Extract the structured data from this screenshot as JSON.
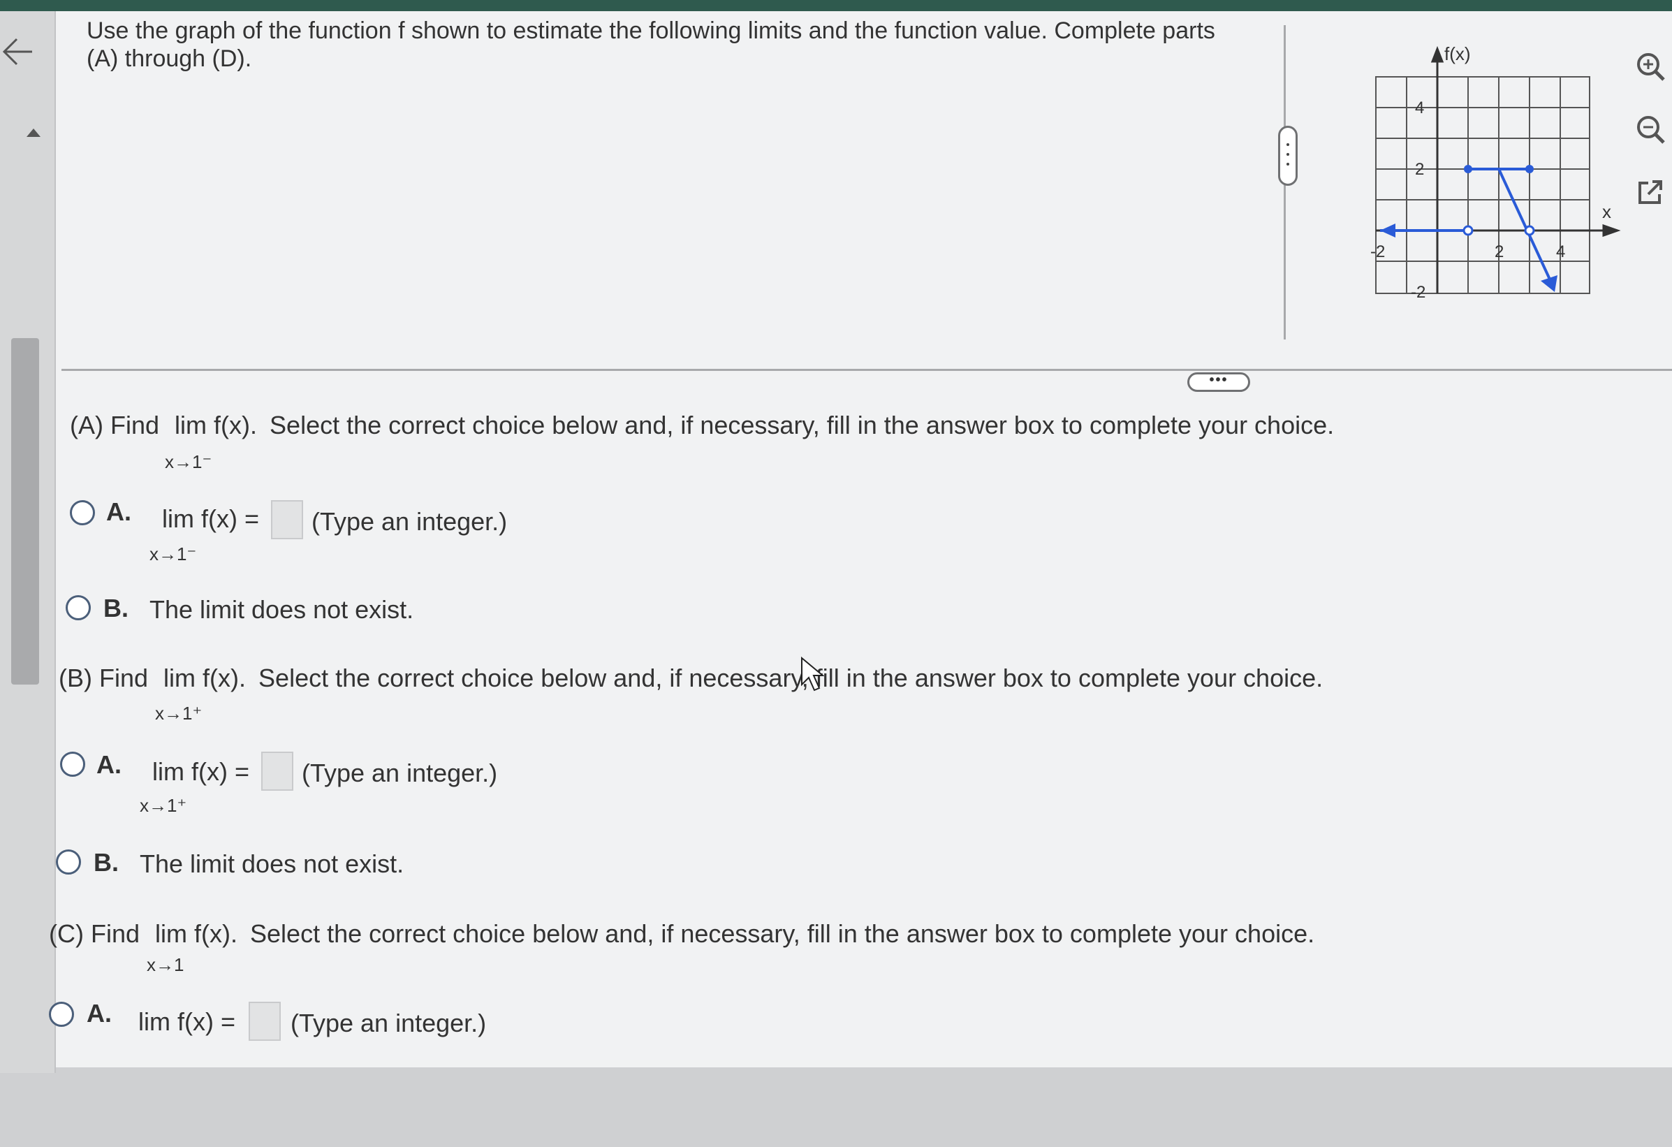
{
  "question": "Use the graph of the function f shown to estimate the following limits and the function value. Complete parts (A) through (D).",
  "graph": {
    "y_label": "f(x)",
    "x_label": "x",
    "y_ticks": [
      "4",
      "2",
      "-2"
    ],
    "x_ticks": [
      "-2",
      "2",
      "4"
    ]
  },
  "handles": {
    "horizontal": "•••"
  },
  "icons": {
    "back": "back-arrow-icon",
    "zoom_in": "zoom-in-icon",
    "zoom_out": "zoom-out-icon",
    "popout": "popout-icon"
  },
  "parts": [
    {
      "label": "(A) Find",
      "lim": "lim f(x).",
      "instruction": "Select the correct choice below and, if necessary, fill in the answer box to complete your choice.",
      "sub": "x→1⁻",
      "choice_a": {
        "letter": "A.",
        "lim": "lim f(x) =",
        "sub": "x→1⁻",
        "hint": "(Type an integer.)"
      },
      "choice_b": {
        "letter": "B.",
        "text": "The limit does not exist."
      }
    },
    {
      "label": "(B) Find",
      "lim": "lim f(x).",
      "instruction": "Select the correct choice below and, if necessary, fill in the answer box to complete your choice.",
      "sub": "x→1⁺",
      "choice_a": {
        "letter": "A.",
        "lim": "lim f(x) =",
        "sub": "x→1⁺",
        "hint": "(Type an integer.)"
      },
      "choice_b": {
        "letter": "B.",
        "text": "The limit does not exist."
      }
    },
    {
      "label": "(C) Find",
      "lim": "lim f(x).",
      "instruction": "Select the correct choice below and, if necessary, fill in the answer box to complete your choice.",
      "sub": "x→1",
      "choice_a": {
        "letter": "A.",
        "lim": "lim f(x) =",
        "hint": "(Type an integer.)"
      }
    }
  ]
}
